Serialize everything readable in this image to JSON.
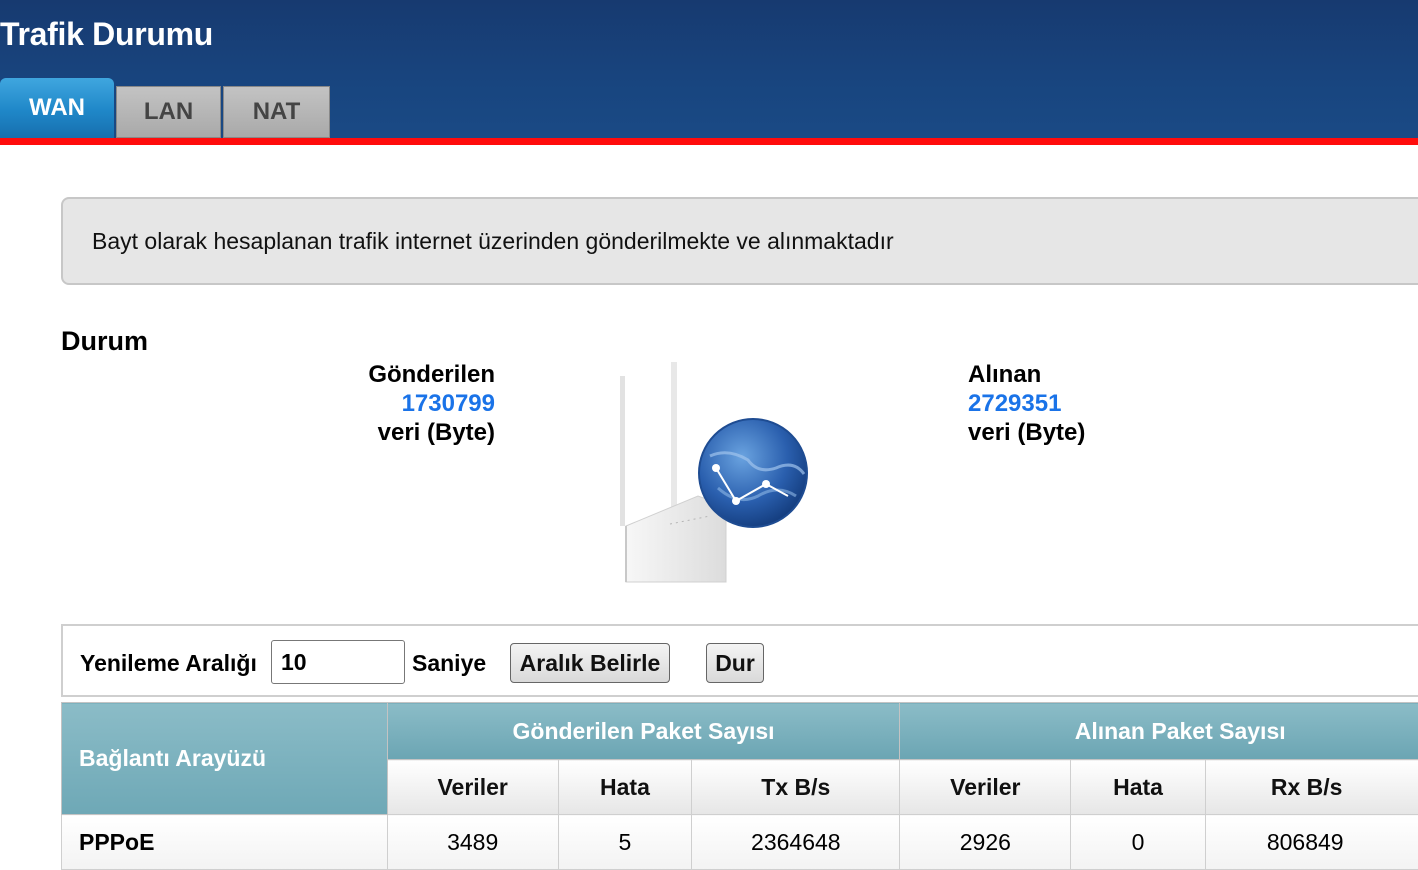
{
  "header": {
    "title": "Trafik Durumu",
    "tabs": [
      {
        "label": "WAN",
        "active": true
      },
      {
        "label": "LAN",
        "active": false
      },
      {
        "label": "NAT",
        "active": false
      }
    ],
    "accent_color": "#ff0c0c",
    "bg_color": "#18457f"
  },
  "info": {
    "text": "Bayt olarak hesaplanan trafik internet üzerinden gönderilmekte ve alınmaktadır"
  },
  "status": {
    "title": "Durum",
    "sent": {
      "label": "Gönderilen",
      "value": "1730799",
      "unit": "veri (Byte)"
    },
    "received": {
      "label": "Alınan",
      "value": "2729351",
      "unit": "veri (Byte)"
    },
    "graphic_icons": [
      "router-icon",
      "globe-icon"
    ]
  },
  "refresh": {
    "label": "Yenileme Aralığı",
    "value": "10",
    "unit": "Saniye",
    "set_button": "Aralık Belirle",
    "stop_button": "Dur"
  },
  "table": {
    "iface_header": "Bağlantı Arayüzü",
    "sent_group": "Gönderilen Paket Sayısı",
    "recv_group": "Alınan Paket Sayısı",
    "sub_headers": {
      "sent_data": "Veriler",
      "sent_error": "Hata",
      "tx": "Tx B/s",
      "recv_data": "Veriler",
      "recv_error": "Hata",
      "rx": "Rx B/s"
    },
    "rows": [
      {
        "iface": "PPPoE",
        "sent_data": "3489",
        "sent_error": "5",
        "tx": "2364648",
        "recv_data": "2926",
        "recv_error": "0",
        "rx": "806849"
      }
    ]
  }
}
